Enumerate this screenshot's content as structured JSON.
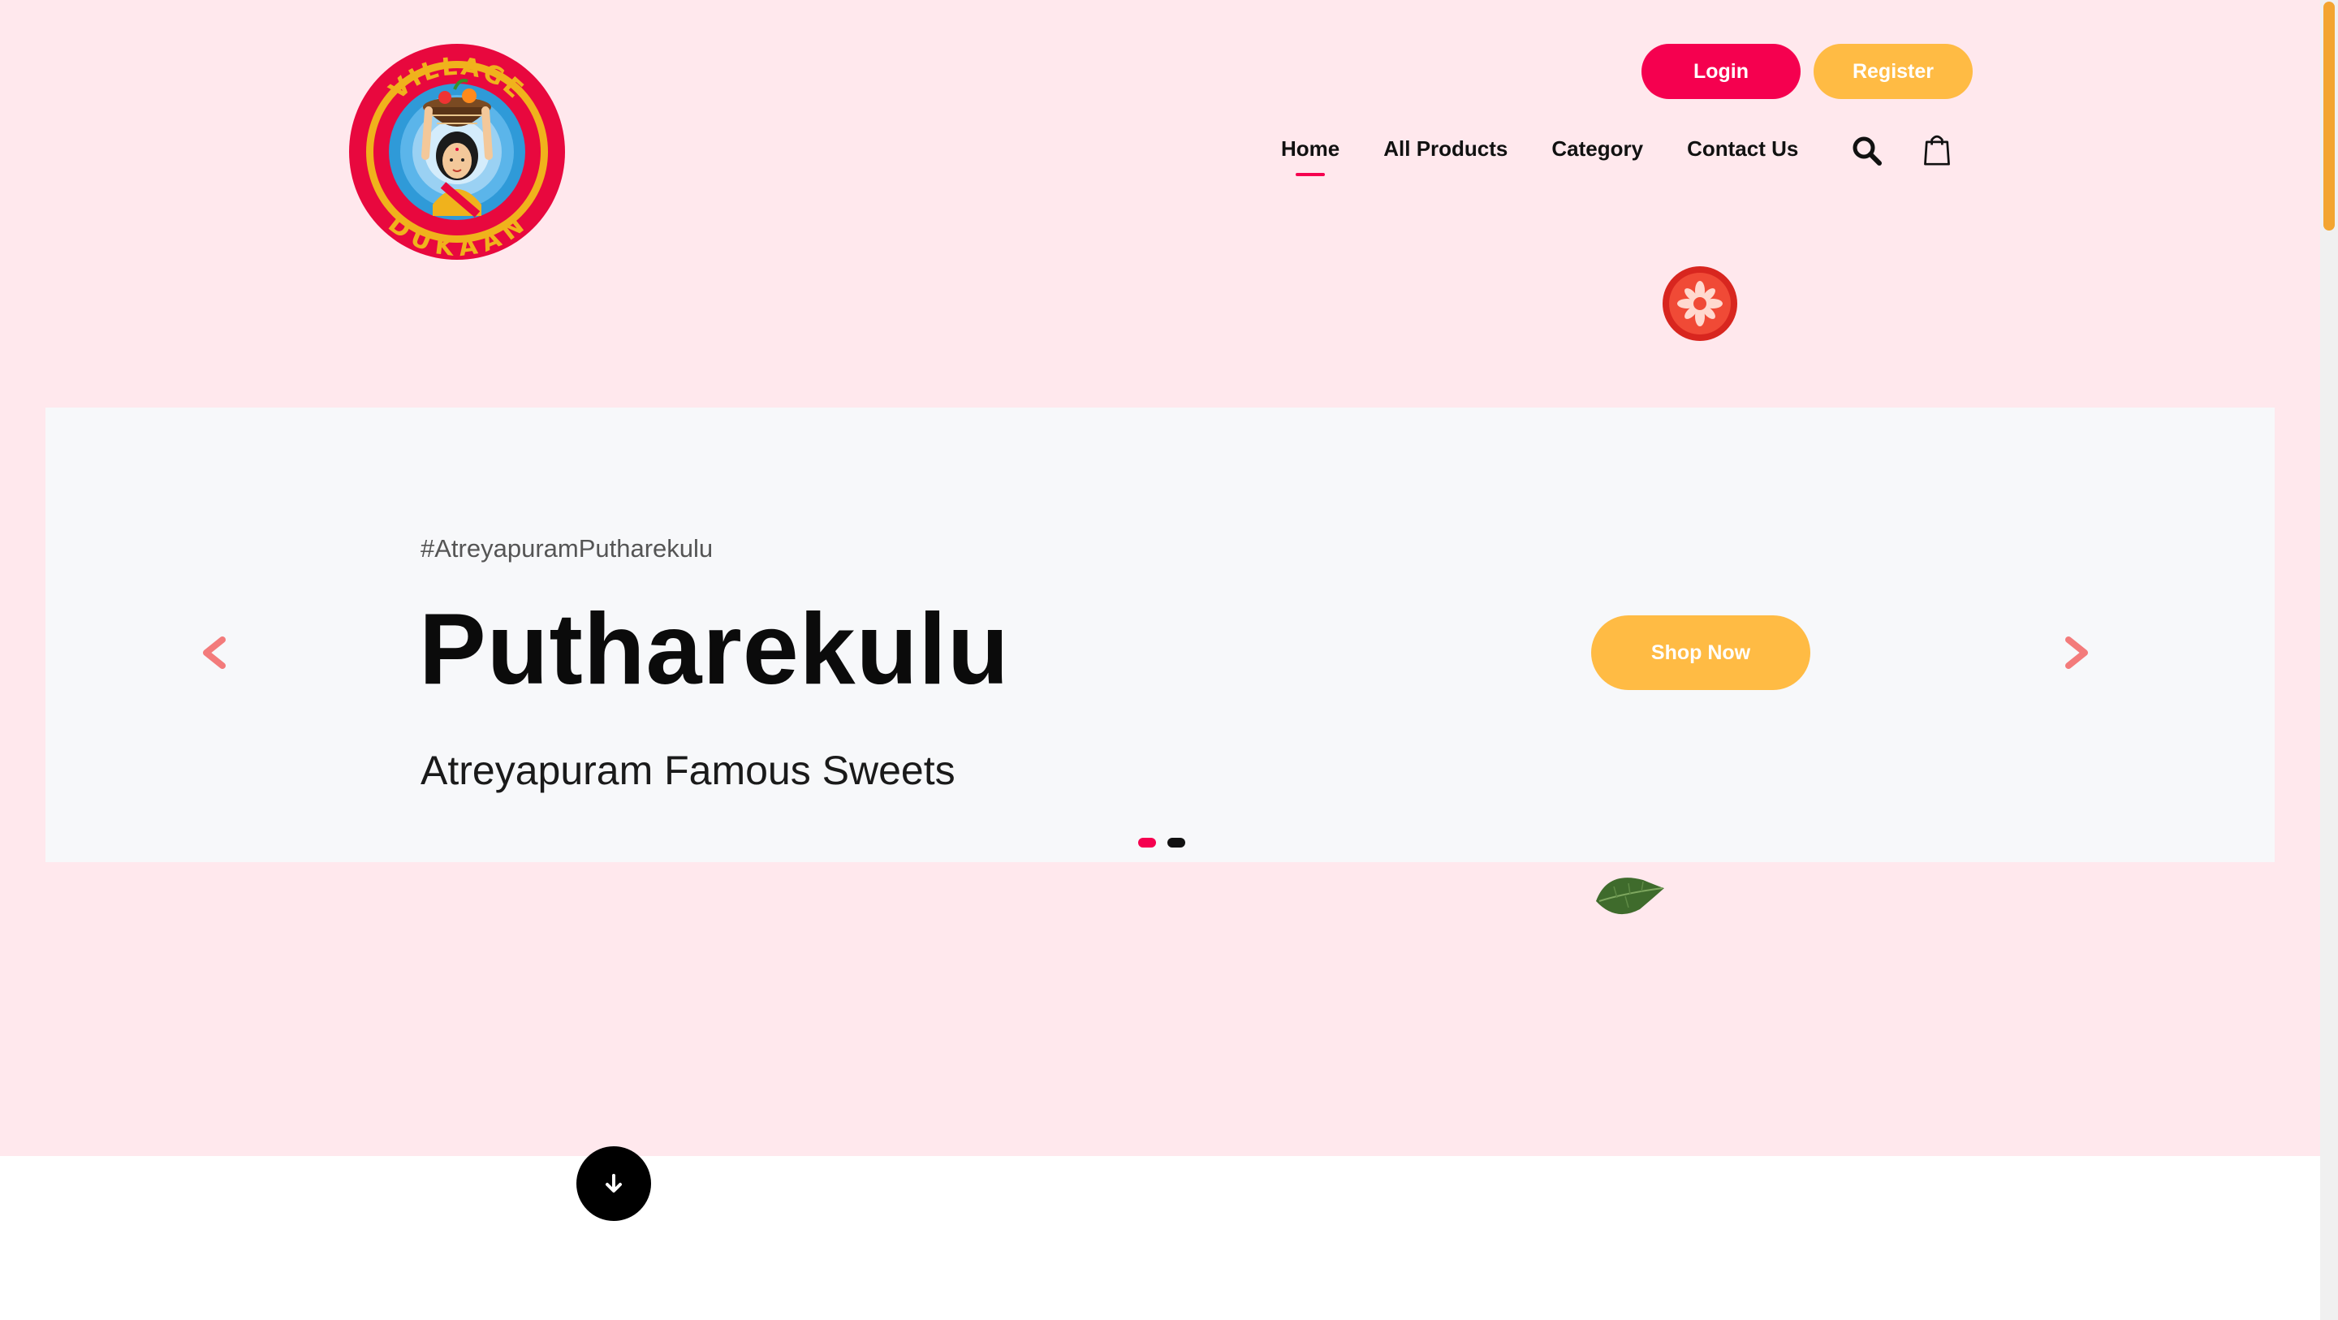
{
  "header": {
    "logo": {
      "top_text": "VILLAGE",
      "bottom_text": "DUKAAN"
    },
    "login_label": "Login",
    "register_label": "Register",
    "nav": [
      {
        "label": "Home",
        "active": true
      },
      {
        "label": "All Products",
        "active": false
      },
      {
        "label": "Category",
        "active": false
      },
      {
        "label": "Contact Us",
        "active": false
      }
    ]
  },
  "slider": {
    "tag": "#AtreyapuramPutharekulu",
    "title": "Putharekulu",
    "subtitle": "Atreyapuram Famous Sweets",
    "cta_label": "Shop Now",
    "active_slide": 1,
    "slide_count": 2
  },
  "colors": {
    "brand_pink": "#f5004f",
    "brand_yellow": "#ffbb44",
    "hero_bg": "#ffe8ed",
    "slider_bg": "#f7f8fa",
    "arrow": "#f37b7b"
  },
  "icons": [
    "search-icon",
    "shopping-bag-icon",
    "chevron-left-icon",
    "chevron-right-icon",
    "arrow-down-icon",
    "tomato-icon",
    "leaf-icon"
  ]
}
